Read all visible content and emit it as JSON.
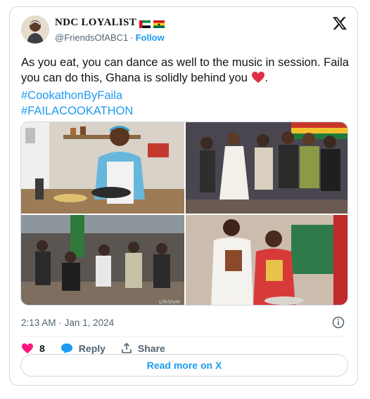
{
  "author": {
    "name": "NDC LOYALIST",
    "handle": "@FriendsOfABC1",
    "separator": "·",
    "follow_label": "Follow",
    "avatar_icon": "person-avatar",
    "flags": [
      "uae-flag",
      "ghana-flag"
    ]
  },
  "tweet": {
    "text": "As you eat, you can dance as well to the music in session. Faila you can do this, Ghana is solidly behind you",
    "text_end": ".",
    "emoji": "red-heart",
    "hashtags": [
      "#CookathonByFaila",
      "#FAILACOOKATHON"
    ]
  },
  "media": {
    "photos": [
      {
        "label": "woman-cooking-photo"
      },
      {
        "label": "crowd-dancing-photo"
      },
      {
        "label": "dancing-crowd-photo"
      },
      {
        "label": "two-women-with-food-photo",
        "watermark": "LifeStyle"
      }
    ]
  },
  "meta": {
    "time": "2:13 AM",
    "separator": "·",
    "date": "Jan 1, 2024"
  },
  "actions": {
    "like_count": "8",
    "reply_label": "Reply",
    "share_label": "Share"
  },
  "read_more_label": "Read more on X",
  "colors": {
    "accent": "#1d9bf0",
    "like": "#f91880",
    "muted": "#536471",
    "border": "#cfd9de"
  }
}
